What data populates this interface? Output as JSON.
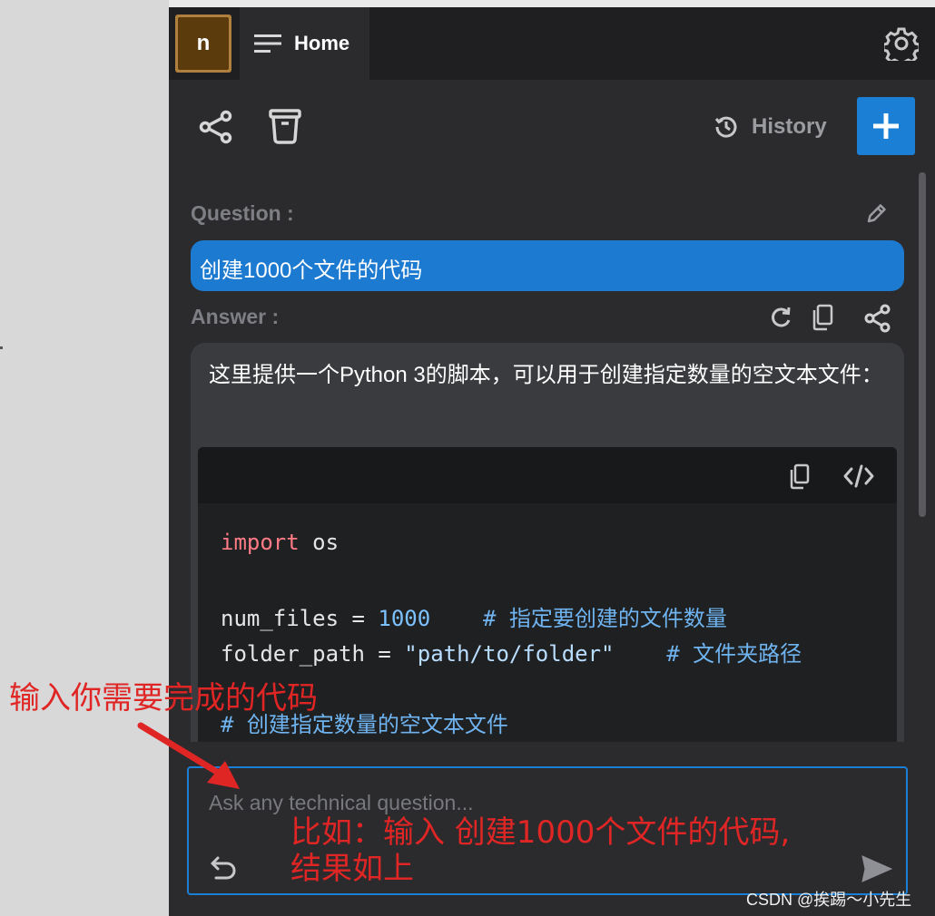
{
  "tabbar": {
    "avatar_letter": "n",
    "home_label": "Home"
  },
  "toolbar": {
    "history_label": "History"
  },
  "question": {
    "label": "Question :",
    "text": "创建1000个文件的代码"
  },
  "answer": {
    "label": "Answer :",
    "text": "这里提供一个Python 3的脚本，可以用于创建指定数量的空文本文件：",
    "code": {
      "line1_kw": "import",
      "line1_rest": " os",
      "line2_var": "num_files = ",
      "line2_num": "1000",
      "line2_comment": "    # 指定要创建的文件数量",
      "line3_var": "folder_path = ",
      "line3_str": "\"path/to/folder\"",
      "line3_comment": "    # 文件夹路径",
      "line4_comment": "# 创建指定数量的空文本文件"
    }
  },
  "input": {
    "placeholder": "Ask any technical question..."
  },
  "annotations": {
    "top": "输入你需要完成的代码",
    "bottom_line1": "比如：输入 创建1000个文件的代码,",
    "bottom_line2": "结果如上"
  },
  "watermark": "CSDN @挨踢～小先生",
  "colors": {
    "accent": "#1c7fd6",
    "annotation": "#e02525"
  }
}
